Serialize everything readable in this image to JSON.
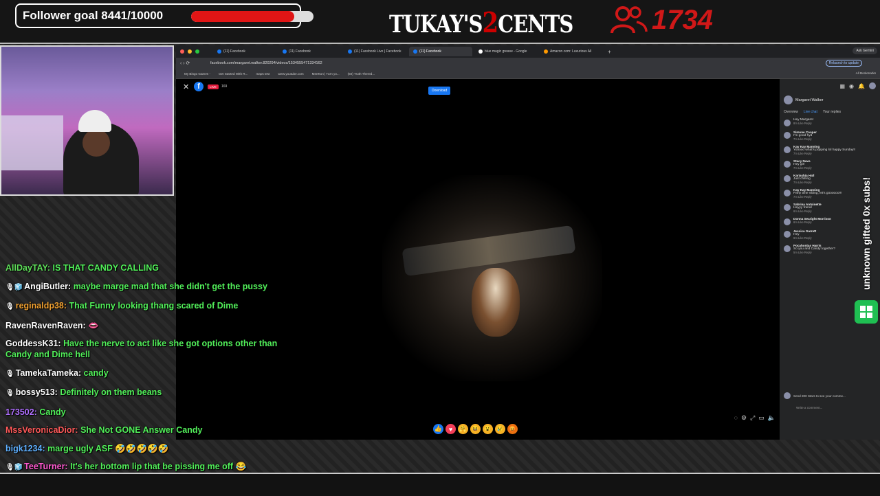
{
  "overlay": {
    "goal_text": "Follower goal 8441/10000",
    "goal_current": 8441,
    "goal_target": 10000,
    "logo": {
      "left": "TUKAY'S",
      "mid": "2",
      "right": "CENTS"
    },
    "viewer_count": "1734",
    "gifted_text": "unknown gifted 0x subs!"
  },
  "browser": {
    "tabs": [
      {
        "label": "(11) Facebook"
      },
      {
        "label": "(11) Facebook"
      },
      {
        "label": "(11) Facebook Live | Facebook"
      },
      {
        "label": "(11) Facebook"
      },
      {
        "label": "blue magic grease - Google"
      },
      {
        "label": "Amazon.com: Luxurious All"
      }
    ],
    "gemini": "Ask Gemini",
    "url": "facebook.com/margaret.walker.820294/videos/1534555471334162",
    "relaunch": "Relaunch to update",
    "bookmarks": [
      "My Bingo Games -",
      "Get Started With R...",
      "maps test",
      "www.youtube.com",
      "MeeKon | Turn yo...",
      "(92) Truth Thered..."
    ],
    "all_bookmarks": "All Bookmarks"
  },
  "video": {
    "live": "LIVE",
    "views": "169",
    "download": "Download"
  },
  "fb_chat": {
    "host": "Margaret Walker",
    "tabs": [
      "Overview",
      "Live chat",
      "Your replies"
    ],
    "messages": [
      {
        "name": "",
        "text": "Hey Margaret",
        "meta": "8m  Like  Reply"
      },
      {
        "name": "Simone Cooper",
        "text": "I'm good hyd",
        "meta": "7m  Like  Reply"
      },
      {
        "name": "Kay Kay Manning",
        "text": "Yooooo what's popping lol happy Sunday!!",
        "meta": "7m  Like  Reply"
      },
      {
        "name": "Stacy Nava",
        "text": "Hey girl",
        "meta": "7m  Like  Reply"
      },
      {
        "name": "Kariashia Hall",
        "text": "Just chilling",
        "meta": "7m  Like  Reply"
      },
      {
        "name": "Kay Kay Manning",
        "text": "Party time vibing, let's goooooo!!!",
        "meta": "7m  Like  Reply"
      },
      {
        "name": "Sabrina Antoinette",
        "text": "Heyyy friend",
        "meta": "6m  Like  Reply"
      },
      {
        "name": "Donna Searight Morrison",
        "text": "",
        "meta": "6m  Like  Reply"
      },
      {
        "name": "Jessica Garrett",
        "text": "Hey",
        "meta": "6m  Like  Reply"
      },
      {
        "name": "Pocahontas Harris",
        "text": "So you and Candy together?",
        "meta": "5m  Like  Reply"
      }
    ],
    "send_stars": "Send 200 Stars to see your comme...",
    "write": "Write a comment..."
  },
  "stream_chat": [
    {
      "badges": "",
      "user": "AllDayTAY",
      "user_color": "#5fe05a",
      "text": "IS THAT CANDY CALLING"
    },
    {
      "badges": "🎙🧊",
      "user": "AngiButler",
      "user_color": "#ffffff",
      "text": "maybe marge mad that she didn't get the pussy"
    },
    {
      "badges": "🎙",
      "user": "reginaldp38",
      "user_color": "#f0a030",
      "text": "That Funny looking thang scared of Dime"
    },
    {
      "badges": "",
      "user": "RavenRavenRaven",
      "user_color": "#ffffff",
      "text": "👄"
    },
    {
      "badges": "",
      "user": "GoddessK31",
      "user_color": "#ffffff",
      "text": "Have the nerve to act like she got options other than Candy and Dime hell"
    },
    {
      "badges": "🎙",
      "user": "TamekaTameka",
      "user_color": "#ffffff",
      "text": "candy"
    },
    {
      "badges": "🎙",
      "user": "bossy513",
      "user_color": "#ffffff",
      "text": "Definitely on them beans"
    },
    {
      "badges": "",
      "user": "173502",
      "user_color": "#b070ff",
      "text": "Candy"
    },
    {
      "badges": "",
      "user": "MssVeronicaDior",
      "user_color": "#ff5a5a",
      "text": "She Not GONE Answer Candy"
    },
    {
      "badges": "",
      "user": "bigk1234",
      "user_color": "#5fb0ff",
      "text": "marge ugly ASF 🤣🤣🤣🤣🤣"
    },
    {
      "badges": "🎙🧊",
      "user": "TeeTurner",
      "user_color": "#ff5ad0",
      "text": "It's her bottom lip that be pissing me off 😂"
    }
  ]
}
